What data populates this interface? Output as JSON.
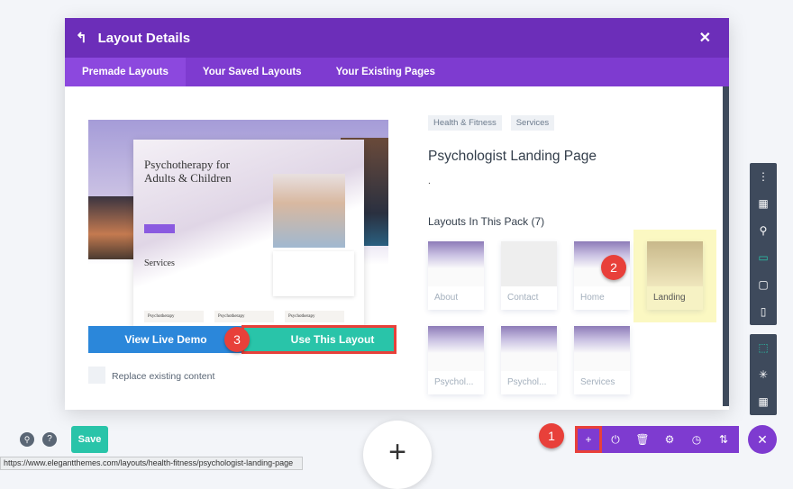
{
  "modal": {
    "title": "Layout Details",
    "tabs": [
      "Premade Layouts",
      "Your Saved Layouts",
      "Your Existing Pages"
    ],
    "preview": {
      "heading": "Psychotherapy for Adults & Children",
      "services": "Services",
      "cards": [
        "Psychotherapy",
        "Psychotherapy",
        "Psychotherapy"
      ]
    },
    "view_demo": "View Live Demo",
    "use_layout": "Use This Layout",
    "replace_label": "Replace existing content",
    "tags": [
      "Health & Fitness",
      "Services"
    ],
    "layout_title": "Psychologist Landing Page",
    "description": ".",
    "pack_title": "Layouts In This Pack (7)",
    "pack": [
      "About",
      "Contact",
      "Home",
      "Landing",
      "Psychol...",
      "Psychol...",
      "Services"
    ]
  },
  "callouts": [
    "1",
    "2",
    "3"
  ],
  "bottom": {
    "save": "Save",
    "status_url": "https://www.elegantthemes.com/layouts/health-fitness/psychologist-landing-page",
    "plus": "+"
  },
  "colors": {
    "header": "#6c2eb9",
    "tabs": "#7e3bd0",
    "demo": "#2b87da",
    "use": "#29c4a9",
    "callout": "#e8403a",
    "highlight": "#fbf8c2"
  }
}
